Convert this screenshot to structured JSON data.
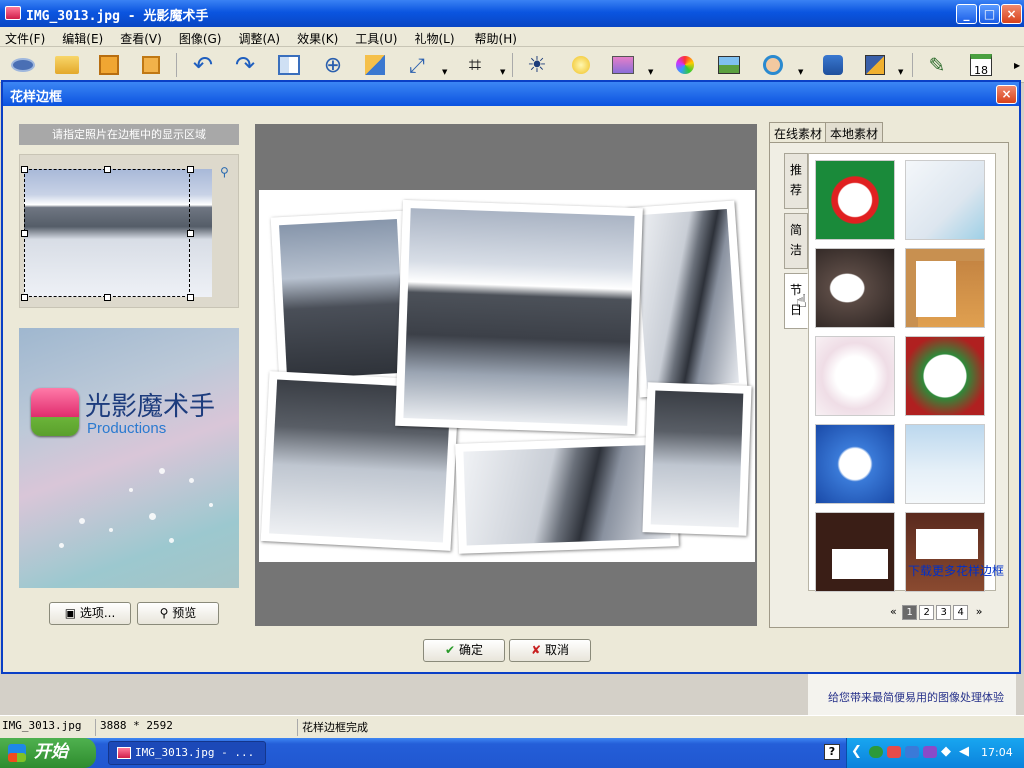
{
  "window": {
    "title": "IMG_3013.jpg - 光影魔术手",
    "min": "_",
    "max": "□",
    "close": "×"
  },
  "menu": [
    "文件(F)",
    "编辑(E)",
    "查看(V)",
    "图像(G)",
    "调整(A)",
    "效果(K)",
    "工具(U)",
    "礼物(L)",
    "帮助(H)"
  ],
  "toolbar": {
    "icons": [
      "open-eye-icon",
      "open-folder-icon",
      "save-icon",
      "save-as-icon",
      "undo-icon",
      "redo-icon",
      "compare-icon",
      "zoom-in-icon",
      "resize-icon",
      "rotate-icon",
      "crop-icon",
      "exposure-icon",
      "light-icon",
      "filter-icon",
      "color-icon",
      "picture-icon",
      "portrait-icon",
      "user-icon",
      "frame-icon",
      "edit-icon",
      "calendar-icon"
    ],
    "calendar_day": "18"
  },
  "dialog": {
    "title": "花样边框",
    "close": "×",
    "prompt": "请指定照片在边框中的显示区域",
    "promo": {
      "brand": "光影魔术手",
      "sub": "Productions"
    },
    "options_button": "选项...",
    "preview_button": "预览",
    "ok_button": "确定",
    "cancel_button": "取消",
    "tabs": [
      "在线素材",
      "本地素材"
    ],
    "vtabs": [
      "推荐",
      "简洁",
      "节日"
    ],
    "pager": {
      "prev": "«",
      "pages": [
        "1",
        "2",
        "3",
        "4"
      ],
      "current": "1",
      "next": "»"
    },
    "more_link": "下载更多花样边框"
  },
  "side_info": "给您带来最简便易用的图像处理体验",
  "status": {
    "file": "IMG_3013.jpg",
    "size": "3888 * 2592",
    "message": "花样边框完成"
  },
  "taskbar": {
    "start": "开始",
    "task": "IMG_3013.jpg - ...",
    "clock": "17:04"
  },
  "colors": {
    "title_blue": "#0a52e0",
    "taskbar_blue": "#245ed8",
    "start_green": "#2e8c2e",
    "link_blue": "#0030c8"
  }
}
